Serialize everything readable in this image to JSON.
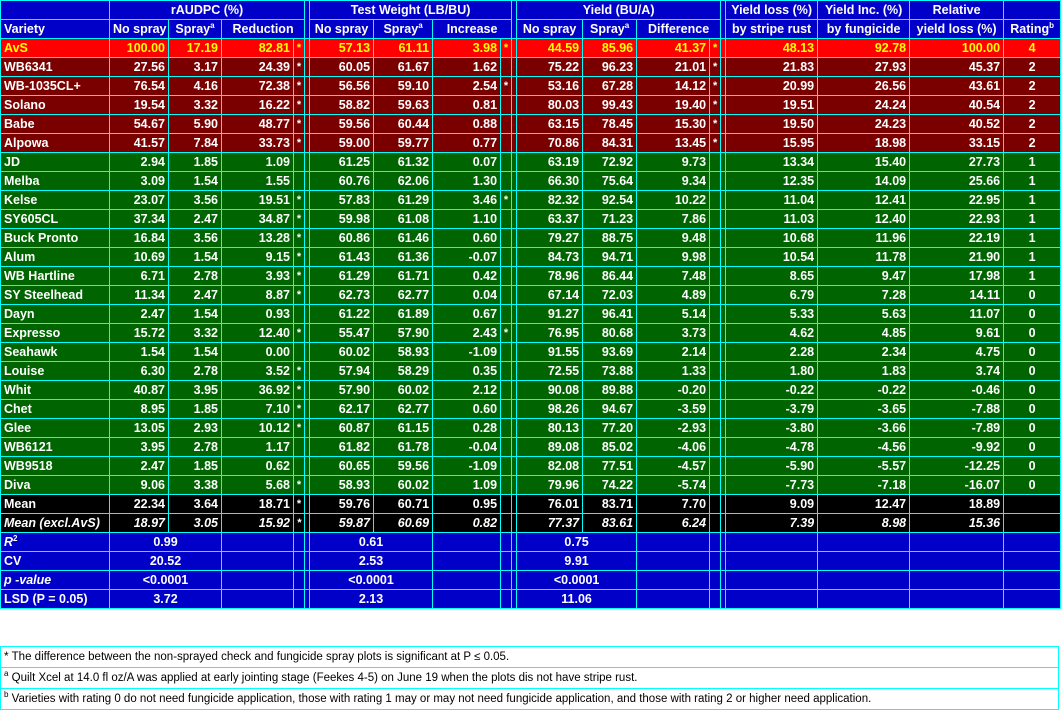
{
  "header": {
    "variety": "Variety",
    "raudpc": "rAUDPC (%)",
    "test_weight": "Test Weight (LB/BU)",
    "yield": "Yield (BU/A)",
    "yield_loss_l1": "Yield loss (%)",
    "yield_loss_l2": "by stripe rust",
    "yield_inc_l1": "Yield Inc. (%)",
    "yield_inc_l2": "by fungicide",
    "relative_l1": "Relative",
    "relative_l2": "yield loss (%)",
    "rating": "Rating",
    "rating_sup": "b",
    "no_spray": "No spray",
    "spray": "Spray",
    "spray_sup": "a",
    "reduction": "Reduction",
    "increase": "Increase",
    "difference": "Difference"
  },
  "rows": [
    {
      "variety": "AvS",
      "color": "yellow",
      "r_ns": "100.00",
      "r_sp": "17.19",
      "r_red": "82.81",
      "r_s": "*",
      "t_ns": "57.13",
      "t_sp": "61.11",
      "t_inc": "3.98",
      "t_s": "*",
      "y_ns": "44.59",
      "y_sp": "85.96",
      "y_diff": "41.37",
      "y_s": "*",
      "loss": "48.13",
      "inc": "92.78",
      "rel": "100.00",
      "rating": "4"
    },
    {
      "variety": "WB6341",
      "color": "red",
      "r_ns": "27.56",
      "r_sp": "3.17",
      "r_red": "24.39",
      "r_s": "*",
      "t_ns": "60.05",
      "t_sp": "61.67",
      "t_inc": "1.62",
      "t_s": "",
      "y_ns": "75.22",
      "y_sp": "96.23",
      "y_diff": "21.01",
      "y_s": "*",
      "loss": "21.83",
      "inc": "27.93",
      "rel": "45.37",
      "rating": "2"
    },
    {
      "variety": "WB-1035CL+",
      "color": "red",
      "r_ns": "76.54",
      "r_sp": "4.16",
      "r_red": "72.38",
      "r_s": "*",
      "t_ns": "56.56",
      "t_sp": "59.10",
      "t_inc": "2.54",
      "t_s": "*",
      "y_ns": "53.16",
      "y_sp": "67.28",
      "y_diff": "14.12",
      "y_s": "*",
      "loss": "20.99",
      "inc": "26.56",
      "rel": "43.61",
      "rating": "2"
    },
    {
      "variety": "Solano",
      "color": "red",
      "r_ns": "19.54",
      "r_sp": "3.32",
      "r_red": "16.22",
      "r_s": "*",
      "t_ns": "58.82",
      "t_sp": "59.63",
      "t_inc": "0.81",
      "t_s": "",
      "y_ns": "80.03",
      "y_sp": "99.43",
      "y_diff": "19.40",
      "y_s": "*",
      "loss": "19.51",
      "inc": "24.24",
      "rel": "40.54",
      "rating": "2"
    },
    {
      "variety": "Babe",
      "color": "red",
      "r_ns": "54.67",
      "r_sp": "5.90",
      "r_red": "48.77",
      "r_s": "*",
      "t_ns": "59.56",
      "t_sp": "60.44",
      "t_inc": "0.88",
      "t_s": "",
      "y_ns": "63.15",
      "y_sp": "78.45",
      "y_diff": "15.30",
      "y_s": "*",
      "loss": "19.50",
      "inc": "24.23",
      "rel": "40.52",
      "rating": "2"
    },
    {
      "variety": "Alpowa",
      "color": "red",
      "r_ns": "41.57",
      "r_sp": "7.84",
      "r_red": "33.73",
      "r_s": "*",
      "t_ns": "59.00",
      "t_sp": "59.77",
      "t_inc": "0.77",
      "t_s": "",
      "y_ns": "70.86",
      "y_sp": "84.31",
      "y_diff": "13.45",
      "y_s": "*",
      "loss": "15.95",
      "inc": "18.98",
      "rel": "33.15",
      "rating": "2"
    },
    {
      "variety": "JD",
      "color": "green",
      "r_ns": "2.94",
      "r_sp": "1.85",
      "r_red": "1.09",
      "r_s": "",
      "t_ns": "61.25",
      "t_sp": "61.32",
      "t_inc": "0.07",
      "t_s": "",
      "y_ns": "63.19",
      "y_sp": "72.92",
      "y_diff": "9.73",
      "y_s": "",
      "loss": "13.34",
      "inc": "15.40",
      "rel": "27.73",
      "rating": "1"
    },
    {
      "variety": "Melba",
      "color": "green",
      "r_ns": "3.09",
      "r_sp": "1.54",
      "r_red": "1.55",
      "r_s": "",
      "t_ns": "60.76",
      "t_sp": "62.06",
      "t_inc": "1.30",
      "t_s": "",
      "y_ns": "66.30",
      "y_sp": "75.64",
      "y_diff": "9.34",
      "y_s": "",
      "loss": "12.35",
      "inc": "14.09",
      "rel": "25.66",
      "rating": "1"
    },
    {
      "variety": "Kelse",
      "color": "green",
      "r_ns": "23.07",
      "r_sp": "3.56",
      "r_red": "19.51",
      "r_s": "*",
      "t_ns": "57.83",
      "t_sp": "61.29",
      "t_inc": "3.46",
      "t_s": "*",
      "y_ns": "82.32",
      "y_sp": "92.54",
      "y_diff": "10.22",
      "y_s": "",
      "loss": "11.04",
      "inc": "12.41",
      "rel": "22.95",
      "rating": "1"
    },
    {
      "variety": "SY605CL",
      "color": "green",
      "r_ns": "37.34",
      "r_sp": "2.47",
      "r_red": "34.87",
      "r_s": "*",
      "t_ns": "59.98",
      "t_sp": "61.08",
      "t_inc": "1.10",
      "t_s": "",
      "y_ns": "63.37",
      "y_sp": "71.23",
      "y_diff": "7.86",
      "y_s": "",
      "loss": "11.03",
      "inc": "12.40",
      "rel": "22.93",
      "rating": "1"
    },
    {
      "variety": "Buck Pronto",
      "color": "green",
      "r_ns": "16.84",
      "r_sp": "3.56",
      "r_red": "13.28",
      "r_s": "*",
      "t_ns": "60.86",
      "t_sp": "61.46",
      "t_inc": "0.60",
      "t_s": "",
      "y_ns": "79.27",
      "y_sp": "88.75",
      "y_diff": "9.48",
      "y_s": "",
      "loss": "10.68",
      "inc": "11.96",
      "rel": "22.19",
      "rating": "1"
    },
    {
      "variety": "Alum",
      "color": "green",
      "r_ns": "10.69",
      "r_sp": "1.54",
      "r_red": "9.15",
      "r_s": "*",
      "t_ns": "61.43",
      "t_sp": "61.36",
      "t_inc": "-0.07",
      "t_s": "",
      "y_ns": "84.73",
      "y_sp": "94.71",
      "y_diff": "9.98",
      "y_s": "",
      "loss": "10.54",
      "inc": "11.78",
      "rel": "21.90",
      "rating": "1"
    },
    {
      "variety": "WB Hartline",
      "color": "green",
      "r_ns": "6.71",
      "r_sp": "2.78",
      "r_red": "3.93",
      "r_s": "*",
      "t_ns": "61.29",
      "t_sp": "61.71",
      "t_inc": "0.42",
      "t_s": "",
      "y_ns": "78.96",
      "y_sp": "86.44",
      "y_diff": "7.48",
      "y_s": "",
      "loss": "8.65",
      "inc": "9.47",
      "rel": "17.98",
      "rating": "1"
    },
    {
      "variety": "SY Steelhead",
      "color": "green",
      "r_ns": "11.34",
      "r_sp": "2.47",
      "r_red": "8.87",
      "r_s": "*",
      "t_ns": "62.73",
      "t_sp": "62.77",
      "t_inc": "0.04",
      "t_s": "",
      "y_ns": "67.14",
      "y_sp": "72.03",
      "y_diff": "4.89",
      "y_s": "",
      "loss": "6.79",
      "inc": "7.28",
      "rel": "14.11",
      "rating": "0"
    },
    {
      "variety": "Dayn",
      "color": "green",
      "r_ns": "2.47",
      "r_sp": "1.54",
      "r_red": "0.93",
      "r_s": "",
      "t_ns": "61.22",
      "t_sp": "61.89",
      "t_inc": "0.67",
      "t_s": "",
      "y_ns": "91.27",
      "y_sp": "96.41",
      "y_diff": "5.14",
      "y_s": "",
      "loss": "5.33",
      "inc": "5.63",
      "rel": "11.07",
      "rating": "0"
    },
    {
      "variety": "Expresso",
      "color": "green",
      "r_ns": "15.72",
      "r_sp": "3.32",
      "r_red": "12.40",
      "r_s": "*",
      "t_ns": "55.47",
      "t_sp": "57.90",
      "t_inc": "2.43",
      "t_s": "*",
      "y_ns": "76.95",
      "y_sp": "80.68",
      "y_diff": "3.73",
      "y_s": "",
      "loss": "4.62",
      "inc": "4.85",
      "rel": "9.61",
      "rating": "0"
    },
    {
      "variety": "Seahawk",
      "color": "green",
      "r_ns": "1.54",
      "r_sp": "1.54",
      "r_red": "0.00",
      "r_s": "",
      "t_ns": "60.02",
      "t_sp": "58.93",
      "t_inc": "-1.09",
      "t_s": "",
      "y_ns": "91.55",
      "y_sp": "93.69",
      "y_diff": "2.14",
      "y_s": "",
      "loss": "2.28",
      "inc": "2.34",
      "rel": "4.75",
      "rating": "0"
    },
    {
      "variety": "Louise",
      "color": "green",
      "r_ns": "6.30",
      "r_sp": "2.78",
      "r_red": "3.52",
      "r_s": "*",
      "t_ns": "57.94",
      "t_sp": "58.29",
      "t_inc": "0.35",
      "t_s": "",
      "y_ns": "72.55",
      "y_sp": "73.88",
      "y_diff": "1.33",
      "y_s": "",
      "loss": "1.80",
      "inc": "1.83",
      "rel": "3.74",
      "rating": "0"
    },
    {
      "variety": "Whit",
      "color": "green",
      "r_ns": "40.87",
      "r_sp": "3.95",
      "r_red": "36.92",
      "r_s": "*",
      "t_ns": "57.90",
      "t_sp": "60.02",
      "t_inc": "2.12",
      "t_s": "",
      "y_ns": "90.08",
      "y_sp": "89.88",
      "y_diff": "-0.20",
      "y_s": "",
      "loss": "-0.22",
      "inc": "-0.22",
      "rel": "-0.46",
      "rating": "0"
    },
    {
      "variety": "Chet",
      "color": "green",
      "r_ns": "8.95",
      "r_sp": "1.85",
      "r_red": "7.10",
      "r_s": "*",
      "t_ns": "62.17",
      "t_sp": "62.77",
      "t_inc": "0.60",
      "t_s": "",
      "y_ns": "98.26",
      "y_sp": "94.67",
      "y_diff": "-3.59",
      "y_s": "",
      "loss": "-3.79",
      "inc": "-3.65",
      "rel": "-7.88",
      "rating": "0"
    },
    {
      "variety": "Glee",
      "color": "green",
      "r_ns": "13.05",
      "r_sp": "2.93",
      "r_red": "10.12",
      "r_s": "*",
      "t_ns": "60.87",
      "t_sp": "61.15",
      "t_inc": "0.28",
      "t_s": "",
      "y_ns": "80.13",
      "y_sp": "77.20",
      "y_diff": "-2.93",
      "y_s": "",
      "loss": "-3.80",
      "inc": "-3.66",
      "rel": "-7.89",
      "rating": "0"
    },
    {
      "variety": "WB6121",
      "color": "green",
      "r_ns": "3.95",
      "r_sp": "2.78",
      "r_red": "1.17",
      "r_s": "",
      "t_ns": "61.82",
      "t_sp": "61.78",
      "t_inc": "-0.04",
      "t_s": "",
      "y_ns": "89.08",
      "y_sp": "85.02",
      "y_diff": "-4.06",
      "y_s": "",
      "loss": "-4.78",
      "inc": "-4.56",
      "rel": "-9.92",
      "rating": "0"
    },
    {
      "variety": "WB9518",
      "color": "green",
      "r_ns": "2.47",
      "r_sp": "1.85",
      "r_red": "0.62",
      "r_s": "",
      "t_ns": "60.65",
      "t_sp": "59.56",
      "t_inc": "-1.09",
      "t_s": "",
      "y_ns": "82.08",
      "y_sp": "77.51",
      "y_diff": "-4.57",
      "y_s": "",
      "loss": "-5.90",
      "inc": "-5.57",
      "rel": "-12.25",
      "rating": "0"
    },
    {
      "variety": "Diva",
      "color": "green",
      "r_ns": "9.06",
      "r_sp": "3.38",
      "r_red": "5.68",
      "r_s": "*",
      "t_ns": "58.93",
      "t_sp": "60.02",
      "t_inc": "1.09",
      "t_s": "",
      "y_ns": "79.96",
      "y_sp": "74.22",
      "y_diff": "-5.74",
      "y_s": "",
      "loss": "-7.73",
      "inc": "-7.18",
      "rel": "-16.07",
      "rating": "0"
    },
    {
      "variety": "Mean",
      "color": "mean",
      "r_ns": "22.34",
      "r_sp": "3.64",
      "r_red": "18.71",
      "r_s": "*",
      "t_ns": "59.76",
      "t_sp": "60.71",
      "t_inc": "0.95",
      "t_s": "",
      "y_ns": "76.01",
      "y_sp": "83.71",
      "y_diff": "7.70",
      "y_s": "",
      "loss": "9.09",
      "inc": "12.47",
      "rel": "18.89",
      "rating": ""
    },
    {
      "variety": "Mean (excl.AvS)",
      "color": "meanx",
      "r_ns": "18.97",
      "r_sp": "3.05",
      "r_red": "15.92",
      "r_s": "*",
      "t_ns": "59.87",
      "t_sp": "60.69",
      "t_inc": "0.82",
      "t_s": "",
      "y_ns": "77.37",
      "y_sp": "83.61",
      "y_diff": "6.24",
      "y_s": "",
      "loss": "7.39",
      "inc": "8.98",
      "rel": "15.36",
      "rating": ""
    }
  ],
  "stats": [
    {
      "label": "R",
      "label_sup": "2",
      "r": "0.99",
      "t": "0.61",
      "y": "0.75"
    },
    {
      "label": "CV",
      "label_sup": "",
      "r": "20.52",
      "t": "2.53",
      "y": "9.91"
    },
    {
      "label": "p -value",
      "label_sup": "",
      "r": "<0.0001",
      "t": "<0.0001",
      "y": "<0.0001"
    },
    {
      "label": "LSD (P = 0.05)",
      "label_sup": "",
      "r": "3.72",
      "t": "2.13",
      "y": "11.06"
    }
  ],
  "notes": [
    {
      "mark": "*",
      "text": " The difference between the non-sprayed check and fungicide spray plots is significant at P ≤ 0.05."
    },
    {
      "mark": "a",
      "text": " Quilt Xcel at 14.0 fl oz/A was applied at early jointing stage (Feekes 4-5) on June 19 when the plots dis not have stripe rust."
    },
    {
      "mark": "b",
      "text": " Varieties with rating 0 do not need fungicide application, those with rating 1 may or may not need fungicide application, and those with rating 2 or  higher need application."
    }
  ],
  "colors": {
    "header_blue": "#0000c8",
    "highlight_red": "#ff0000",
    "highlight_text_yellow": "#ffff00",
    "susceptible_dark_red": "#7a0000",
    "resistant_green": "#006400",
    "mean_black": "#000000",
    "grid_cyan": "#00ffff"
  }
}
